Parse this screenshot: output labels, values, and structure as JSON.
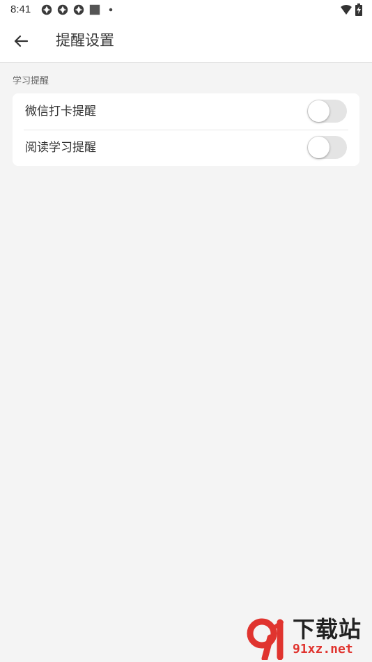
{
  "status_bar": {
    "time": "8:41",
    "left_icons": [
      "aperture-icon",
      "aperture-icon",
      "aperture-icon",
      "square-icon",
      "dot-icon"
    ],
    "right_icons": [
      "wifi-icon",
      "battery-charging-icon"
    ]
  },
  "app_bar": {
    "back_icon": "arrow-left-icon",
    "title": "提醒设置"
  },
  "section": {
    "label": "学习提醒",
    "items": [
      {
        "label": "微信打卡提醒",
        "enabled": false
      },
      {
        "label": "阅读学习提醒",
        "enabled": false
      }
    ]
  },
  "watermark": {
    "logo_text": "91",
    "title": "下载站",
    "url": "91xz.net"
  },
  "colors": {
    "background": "#f4f4f4",
    "surface": "#ffffff",
    "switch_off_track": "#e4e4e4",
    "watermark_red": "#e0342f"
  }
}
